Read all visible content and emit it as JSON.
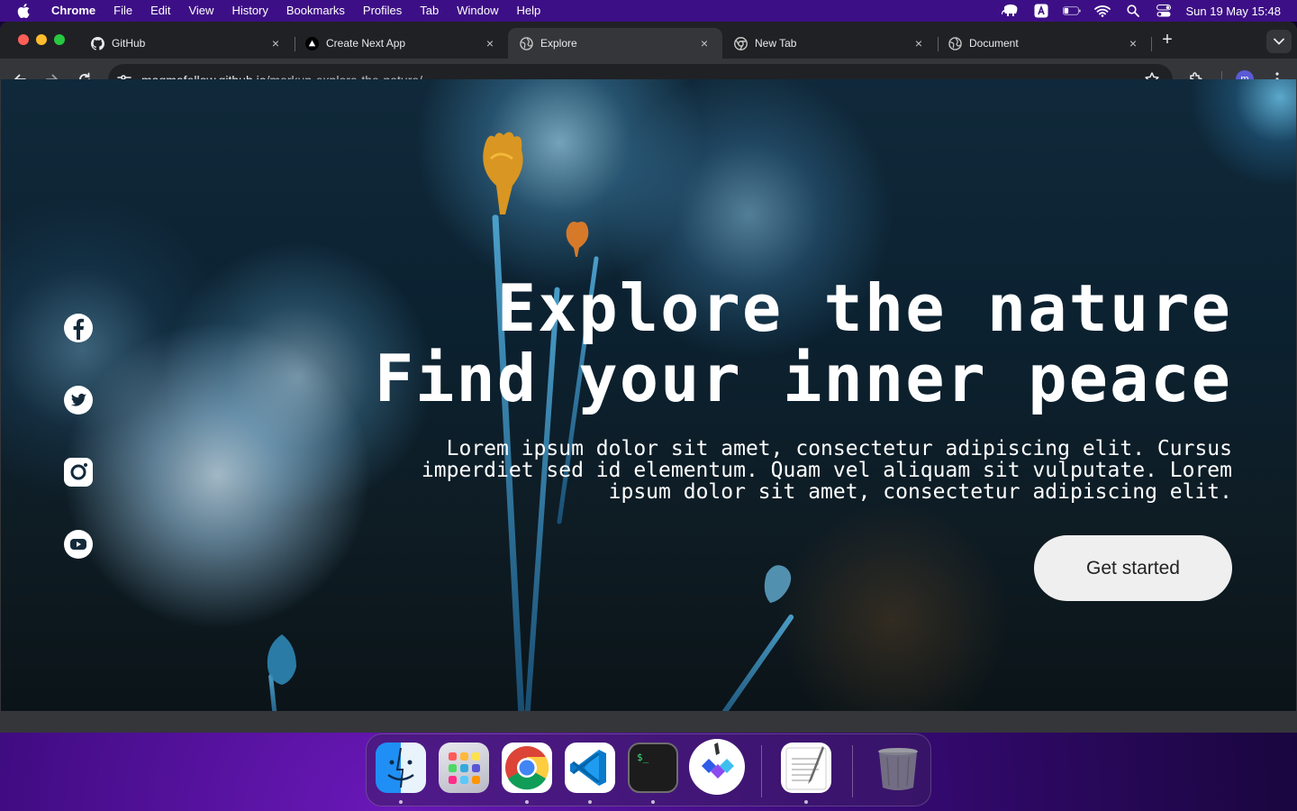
{
  "menubar": {
    "app_name": "Chrome",
    "menus": [
      "File",
      "Edit",
      "View",
      "History",
      "Bookmarks",
      "Profiles",
      "Tab",
      "Window",
      "Help"
    ],
    "clock": "Sun 19 May  15:48",
    "status_icons": [
      "elephant-icon",
      "keyboard-input-a-icon",
      "battery-icon",
      "wifi-icon",
      "spotlight-search-icon",
      "control-center-icon"
    ]
  },
  "browser": {
    "tabs": [
      {
        "title": "GitHub",
        "icon": "github-icon",
        "active": false
      },
      {
        "title": "Create Next App",
        "icon": "nextjs-triangle-icon",
        "active": false
      },
      {
        "title": "Explore",
        "icon": "globe-icon",
        "active": true
      },
      {
        "title": "New Tab",
        "icon": "chrome-icon",
        "active": false
      },
      {
        "title": "Document",
        "icon": "globe-icon",
        "active": false
      }
    ],
    "close_glyph": "×",
    "new_tab_glyph": "+",
    "url_host": "magmafellow.github.io",
    "url_path": "/markup-explore-the-nature/",
    "profile_initial": "m"
  },
  "page": {
    "title_line1": "Explore the nature",
    "title_line2": "Find your inner peace",
    "description": "Lorem ipsum dolor sit amet, consectetur adipiscing elit. Cursus imperdiet sed id elementum. Quam vel aliquam sit vulputate. Lorem ipsum dolor sit amet, consectetur adipiscing elit.",
    "cta_label": "Get started",
    "social_links": [
      "facebook-icon",
      "twitter-icon",
      "instagram-icon",
      "youtube-icon"
    ]
  },
  "dock": {
    "apps": [
      {
        "name": "Finder",
        "running": true
      },
      {
        "name": "Launchpad",
        "running": false
      },
      {
        "name": "Google Chrome",
        "running": true
      },
      {
        "name": "Visual Studio Code",
        "running": true
      },
      {
        "name": "Terminal",
        "running": true
      },
      {
        "name": "Wunderbucket",
        "running": false
      },
      {
        "name": "TextEdit",
        "running": true
      },
      {
        "name": "Trash",
        "running": false
      }
    ]
  },
  "colors": {
    "menubar_bg": "#3d0f86",
    "tabstrip_bg": "#202124",
    "toolbar_bg": "#35363a",
    "cta_bg": "#efefef"
  }
}
